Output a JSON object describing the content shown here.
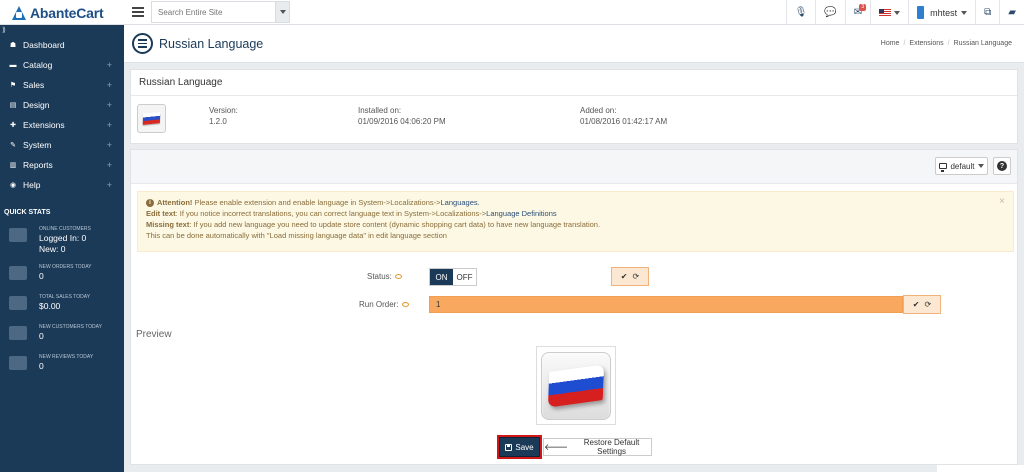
{
  "app": {
    "logo_text": "AbanteCart",
    "search_placeholder": "Search Entire Site",
    "mail_count": "3",
    "user_name": "mhtest"
  },
  "sidebar": {
    "toggle_glyph": "⟫",
    "items": [
      {
        "label": "Dashboard",
        "icon": "dashboard-icon",
        "glyph": "☗",
        "expandable": false
      },
      {
        "label": "Catalog",
        "icon": "folder-icon",
        "glyph": "▬",
        "expandable": true
      },
      {
        "label": "Sales",
        "icon": "flag-icon",
        "glyph": "⚑",
        "expandable": true
      },
      {
        "label": "Design",
        "icon": "file-icon",
        "glyph": "▤",
        "expandable": true
      },
      {
        "label": "Extensions",
        "icon": "puzzle-icon",
        "glyph": "✚",
        "expandable": true
      },
      {
        "label": "System",
        "icon": "wrench-icon",
        "glyph": "✎",
        "expandable": true
      },
      {
        "label": "Reports",
        "icon": "bar-chart-icon",
        "glyph": "▥",
        "expandable": true
      },
      {
        "label": "Help",
        "icon": "globe-icon",
        "glyph": "◉",
        "expandable": true
      }
    ],
    "quick_stats_title": "QUICK STATS",
    "stats": [
      {
        "label": "ONLINE CUSTOMERS",
        "value": "Logged In: 0",
        "value2": "New: 0"
      },
      {
        "label": "NEW ORDERS TODAY",
        "value": "0"
      },
      {
        "label": "TOTAL SALES TODAY",
        "value": "$0.00"
      },
      {
        "label": "NEW CUSTOMERS TODAY",
        "value": "0"
      },
      {
        "label": "NEW REVIEWS TODAY",
        "value": "0"
      }
    ]
  },
  "header": {
    "title": "Russian Language",
    "breadcrumb": [
      "Home",
      "Extensions",
      "Russian Language"
    ],
    "separator": "/"
  },
  "extension": {
    "name": "Russian Language",
    "version_label": "Version:",
    "version": "1.2.0",
    "installed_label": "Installed on:",
    "installed": "01/09/2016 04:06:20 PM",
    "added_label": "Added on:",
    "added": "01/08/2016 01:42:17 AM"
  },
  "toolbar": {
    "default_label": "default",
    "help_glyph": "?"
  },
  "alert": {
    "attention_label": "Attention!",
    "attention_text": "Please enable extension and enable language in System->Localizations->",
    "languages_link": "Languages.",
    "edit_label": "Edit text",
    "edit_text": ": If you notice incorrect translations, you can correct language text in System->Localizations->",
    "definitions_link": "Language Definitions",
    "missing_label": "Missing text",
    "missing_text": ": If you add new language you need to update store content (dynamic shopping cart data) to have new language translation.",
    "auto_text": "This can be done automatically with \"Load missing language data\" in edit language section",
    "close_glyph": "×"
  },
  "form": {
    "status_label": "Status:",
    "status_on": "ON",
    "status_off": "OFF",
    "run_order_label": "Run Order:",
    "run_order_value": "1",
    "check_glyph": "✔",
    "reset_glyph": "⟳"
  },
  "preview": {
    "title": "Preview"
  },
  "actions": {
    "save_label": "Save",
    "restore_label": "Restore Default Settings",
    "restore_glyph": "🡐"
  }
}
